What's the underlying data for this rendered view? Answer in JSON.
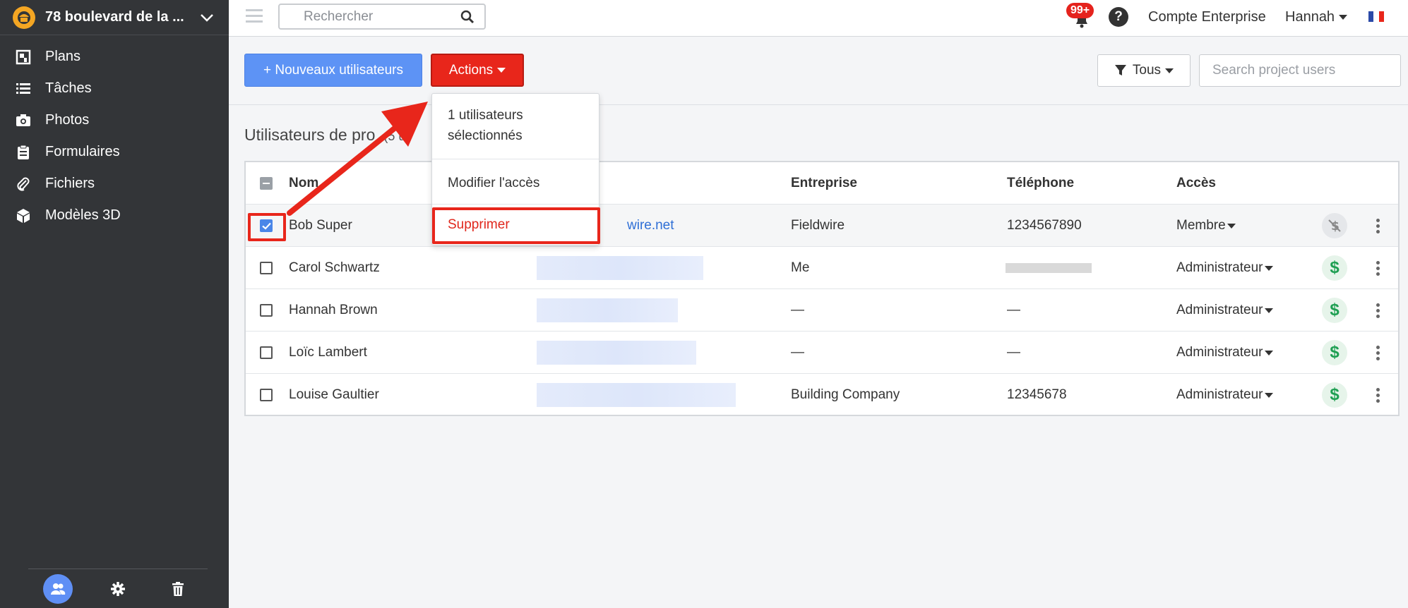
{
  "sidebar": {
    "project_name": "78 boulevard de la ...",
    "items": [
      {
        "label": "Plans",
        "icon": "plans-icon"
      },
      {
        "label": "Tâches",
        "icon": "list-icon"
      },
      {
        "label": "Photos",
        "icon": "camera-icon"
      },
      {
        "label": "Formulaires",
        "icon": "clipboard-icon"
      },
      {
        "label": "Fichiers",
        "icon": "paperclip-icon"
      },
      {
        "label": "Modèles 3D",
        "icon": "cube-icon"
      }
    ],
    "footer_icons": [
      "users-icon",
      "gear-icon",
      "trash-icon"
    ]
  },
  "topbar": {
    "search_placeholder": "Rechercher",
    "notif_badge": "99+",
    "help": "?",
    "account": "Compte Enterprise",
    "user": "Hannah"
  },
  "toolbar": {
    "new_users_label": "+ Nouveaux utilisateurs",
    "actions_label": "Actions",
    "filter_label": "Tous",
    "search_placeholder": "Search project users"
  },
  "section": {
    "title": "Utilisateurs de pro",
    "count": "(5 u"
  },
  "table": {
    "headers": {
      "name": "Nom",
      "company": "Entreprise",
      "phone": "Téléphone",
      "access": "Accès"
    },
    "rows": [
      {
        "name": "Bob Super",
        "email": "wire.net",
        "company": "Fieldwire",
        "phone": "1234567890",
        "access": "Membre",
        "checked": true,
        "billing": "off"
      },
      {
        "name": "Carol Schwartz",
        "email": "",
        "company": "Me",
        "phone": "",
        "access": "Administrateur",
        "checked": false,
        "billing": "on"
      },
      {
        "name": "Hannah Brown",
        "email": "",
        "company": "—",
        "phone": "—",
        "access": "Administrateur",
        "checked": false,
        "billing": "on"
      },
      {
        "name": "Loïc Lambert",
        "email": "",
        "company": "—",
        "phone": "—",
        "access": "Administrateur",
        "checked": false,
        "billing": "on"
      },
      {
        "name": "Louise Gaultier",
        "email": "",
        "company": "Building Company",
        "phone": "12345678",
        "access": "Administrateur",
        "checked": false,
        "billing": "on"
      }
    ]
  },
  "dropdown": {
    "selected_info": "1 utilisateurs sélectionnés",
    "selected_line1": "1 utilisateurs",
    "selected_line2": "sélectionnés",
    "modify_access": "Modifier l'accès",
    "delete": "Supprimer"
  },
  "colors": {
    "sidebar_bg": "#333538",
    "primary_blue": "#5d93f5",
    "danger_red": "#e8261b",
    "billing_green": "#1e9f52"
  }
}
